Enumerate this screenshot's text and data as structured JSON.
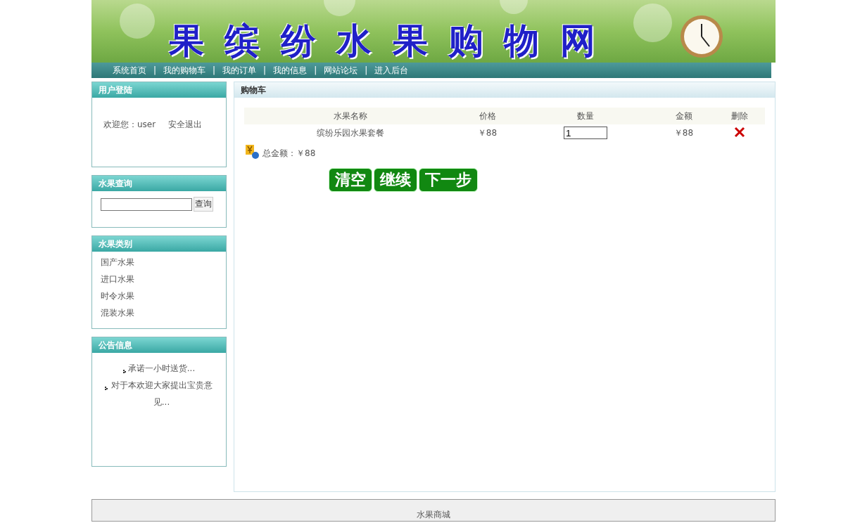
{
  "banner": {
    "title": "果 缤 纷 水 果 购 物 网"
  },
  "nav": [
    "系统首页",
    "我的购物车",
    "我的订单",
    "我的信息",
    "网站论坛",
    "进入后台"
  ],
  "nav_separator": "|",
  "login_panel": {
    "title": "用户登陆",
    "welcome": "欢迎您：user",
    "logout": "安全退出"
  },
  "search_panel": {
    "title": "水果查询",
    "button": "查询"
  },
  "category_panel": {
    "title": "水果类别",
    "items": [
      "国产水果",
      "进口水果",
      "时令水果",
      "混装水果"
    ]
  },
  "notice_panel": {
    "title": "公告信息",
    "items": [
      "承诺一小时送货...",
      "对于本欢迎大家提出宝贵意见..."
    ]
  },
  "cart": {
    "title": "购物车",
    "columns": [
      "水果名称",
      "价格",
      "数量",
      "金额",
      "删除"
    ],
    "rows": [
      {
        "name": "缤纷乐园水果套餐",
        "price": "￥88",
        "quantity": "1",
        "amount": "￥88"
      }
    ],
    "total": "总金额：￥88",
    "buttons": [
      "清空",
      "继续",
      "下一步"
    ]
  },
  "footer": "水果商城"
}
